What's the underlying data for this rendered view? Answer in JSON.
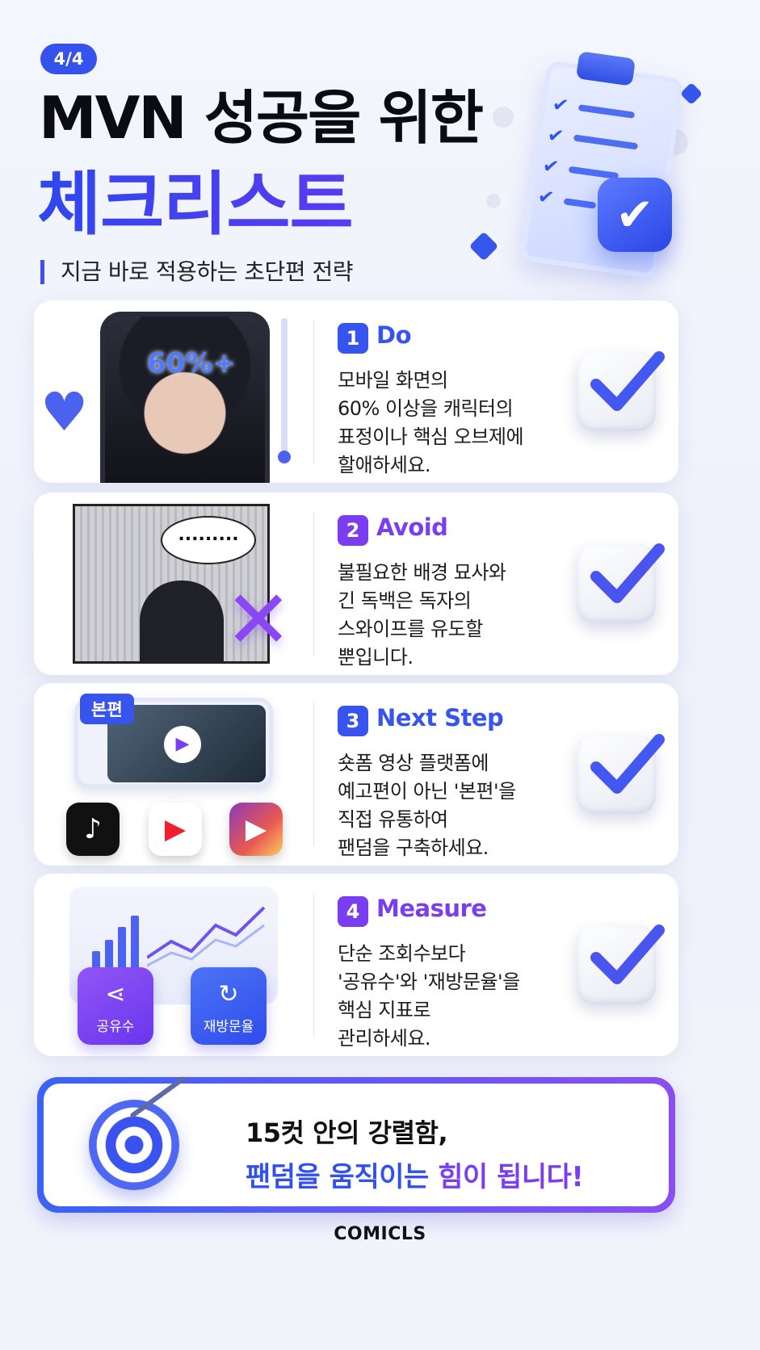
{
  "header": {
    "badge": "4/4",
    "title_line1": "MVN 성공을 위한",
    "title_line2": "체크리스트",
    "subtitle": "지금 바로 적용하는 초단편 전략"
  },
  "cards": [
    {
      "number": "1",
      "heading": "Do",
      "lines": [
        "모바일 화면의",
        "60% 이상을 캐릭터의",
        "표정이나 핵심 오브제에",
        "할애하세요."
      ],
      "visual_label": "60%+",
      "accent": "#3854ef"
    },
    {
      "number": "2",
      "heading": "Avoid",
      "lines": [
        "불필요한 배경 묘사와",
        "긴 독백은 독자의",
        "스와이프를 유도할",
        "뿐입니다."
      ],
      "visual_label": ".........",
      "accent": "#7a3df0"
    },
    {
      "number": "3",
      "heading": "Next Step",
      "lines": [
        "숏폼 영상 플랫폼에",
        "예고편이 아닌 '본편'을",
        "직접 유통하여",
        "팬덤을 구축하세요."
      ],
      "visual_label": "본편",
      "accent": "#3854ef"
    },
    {
      "number": "4",
      "heading": "Measure",
      "lines": [
        "단순 조회수보다",
        "'공유수'와 '재방문율'을",
        "핵심 지표로",
        "관리하세요."
      ],
      "tiles": [
        "공유수",
        "재방문율"
      ],
      "accent": "#7a3df0"
    }
  ],
  "banner": {
    "line1": "15컷 안의 강렬함,",
    "line2_part1": "팬덤을 움직이는 ",
    "line2_part2": "힘이 됩니다!"
  },
  "footer": "COMICLS",
  "colors": {
    "primary": "#3854ef",
    "secondary": "#7a3df0"
  },
  "icons": [
    "clipboard-icon",
    "heart-icon",
    "x-mark-icon",
    "play-icon",
    "tiktok-icon",
    "youtube-shorts-icon",
    "instagram-reels-icon",
    "share-icon",
    "revisit-icon",
    "target-icon",
    "check-icon"
  ]
}
